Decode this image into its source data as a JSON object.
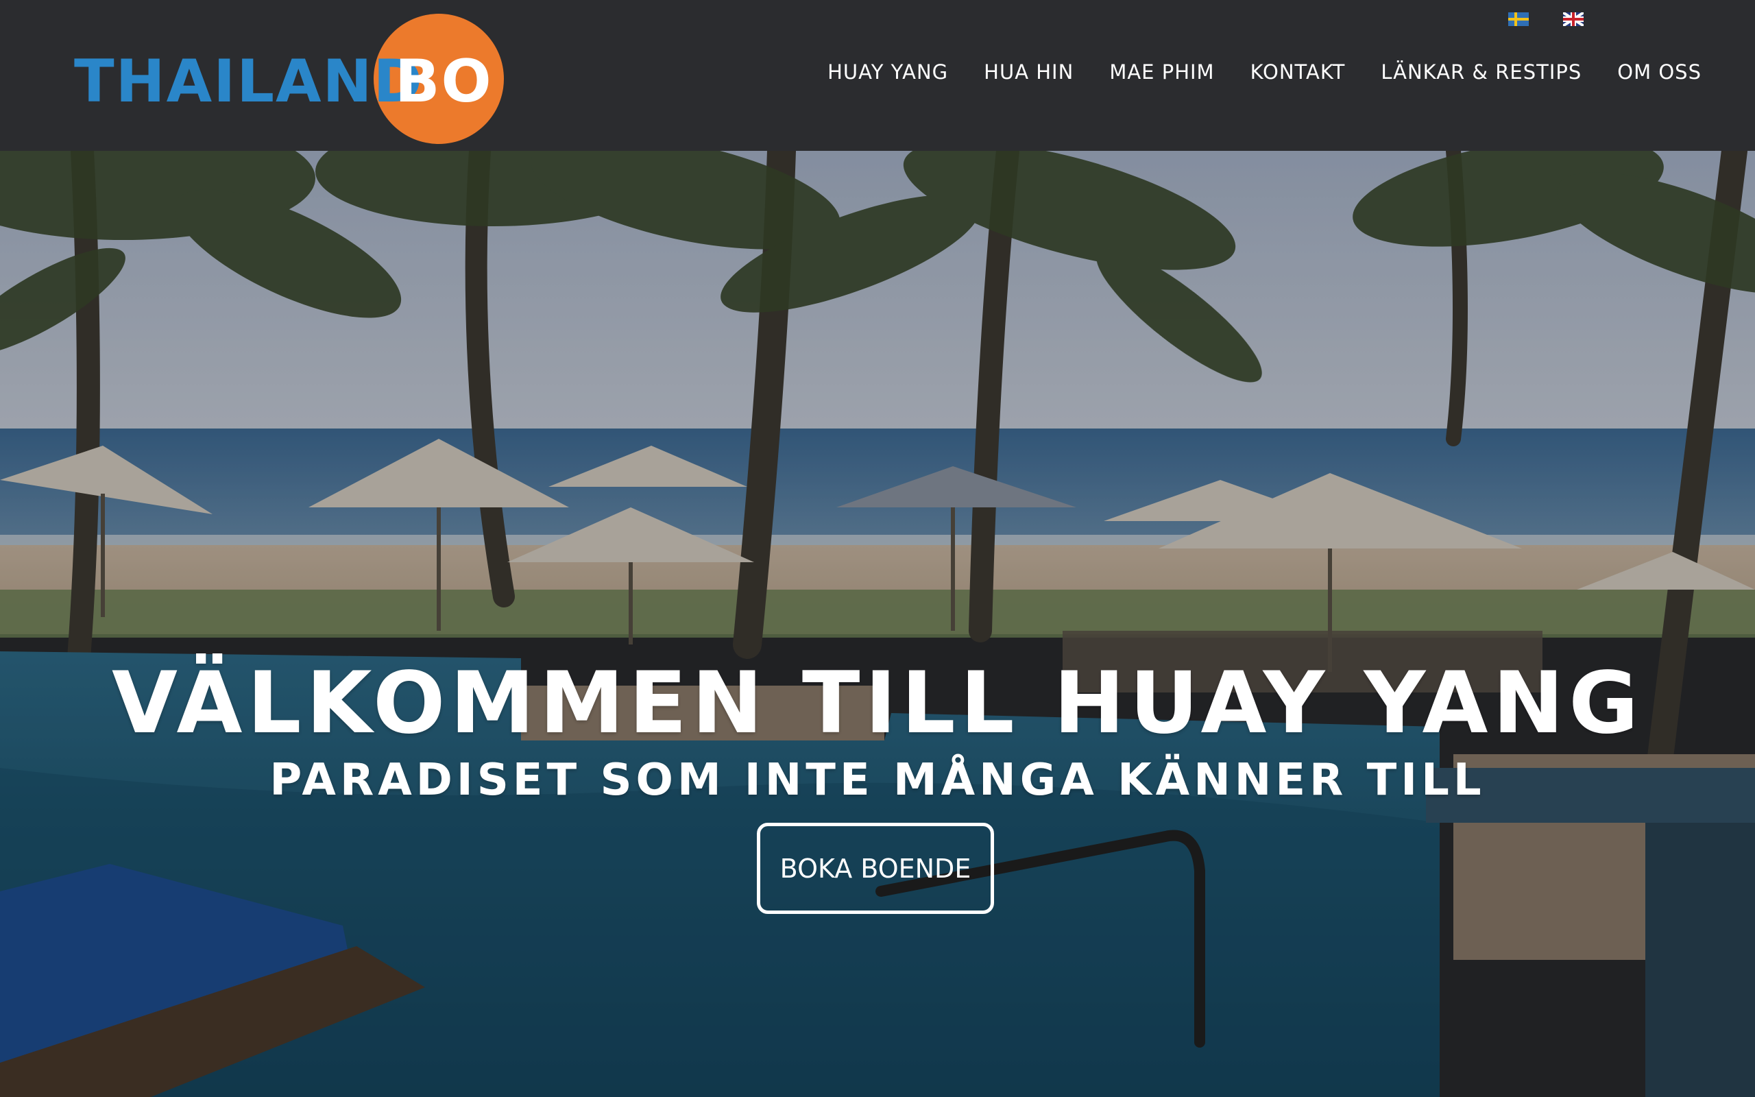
{
  "logo": {
    "part1": "THAILAND",
    "part2": "BO"
  },
  "language": {
    "options": [
      "Svenska",
      "English"
    ]
  },
  "nav": {
    "items": [
      {
        "label": "HUAY YANG"
      },
      {
        "label": "HUA HIN"
      },
      {
        "label": "MAE PHIM"
      },
      {
        "label": "KONTAKT"
      },
      {
        "label": "LÄNKAR & RESTIPS"
      },
      {
        "label": "OM OSS"
      }
    ]
  },
  "hero": {
    "title": "VÄLKOMMEN TILL HUAY YANG",
    "subtitle": "PARADISET SOM INTE MÅNGA KÄNNER TILL",
    "cta_label": "BOKA BOENDE"
  },
  "colors": {
    "header_bg": "#2b2c2f",
    "logo_blue": "#2a86c9",
    "logo_orange": "#ec7a2c"
  }
}
